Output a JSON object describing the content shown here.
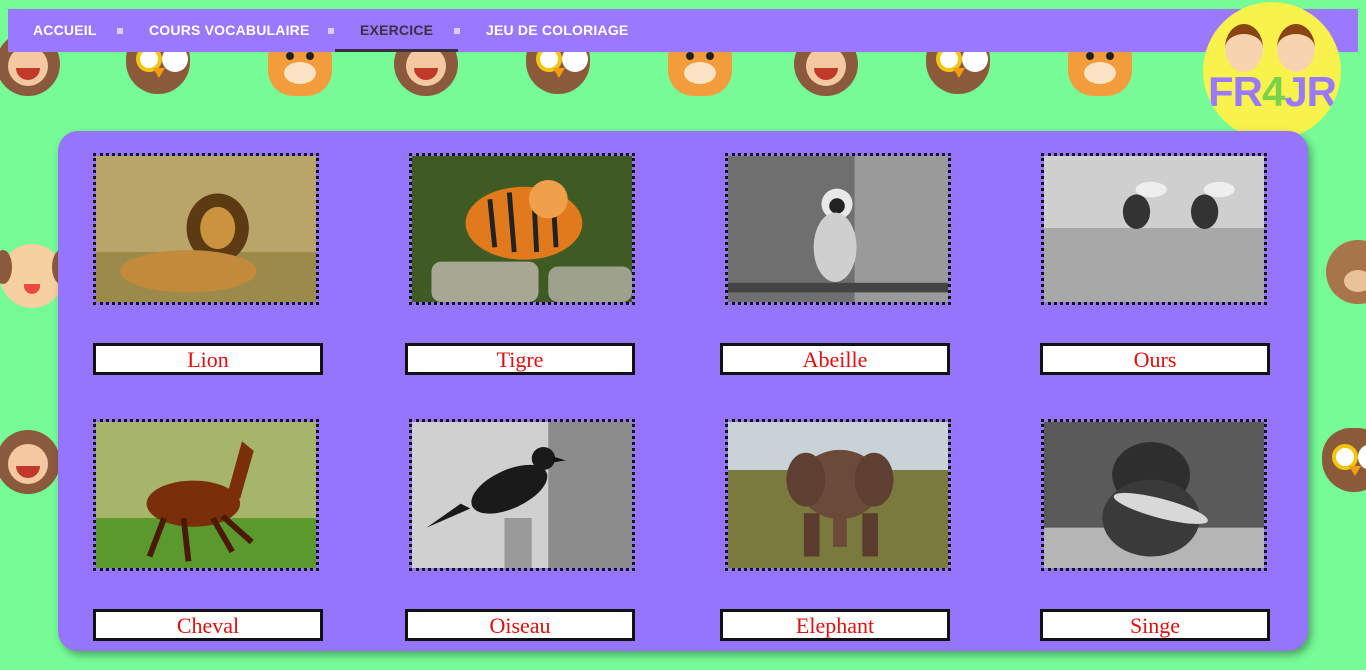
{
  "nav": {
    "items": [
      {
        "label": "ACCUEIL"
      },
      {
        "label": "COURS VOCABULAIRE"
      },
      {
        "label": "EXERCICE"
      },
      {
        "label": "JEU DE COLORIAGE"
      }
    ],
    "active": "EXERCICE",
    "background_color": "#9a78ff"
  },
  "logo": {
    "prefix": "FR",
    "number": "4",
    "suffix": "JR"
  },
  "exercise": {
    "cards": [
      {
        "image": "lion-photo",
        "label": "Lion"
      },
      {
        "image": "tiger-photo",
        "label": "Tigre"
      },
      {
        "image": "monkey-photo",
        "label": "Abeille"
      },
      {
        "image": "bees-photo",
        "label": "Ours"
      },
      {
        "image": "horse-photo",
        "label": "Cheval"
      },
      {
        "image": "bird-photo",
        "label": "Oiseau"
      },
      {
        "image": "elephant-photo",
        "label": "Elephant"
      },
      {
        "image": "bear-photo",
        "label": "Singe"
      }
    ],
    "label_color": "#e01010",
    "panel_color": "#9575fd"
  },
  "page": {
    "background_color": "#76fb96"
  }
}
